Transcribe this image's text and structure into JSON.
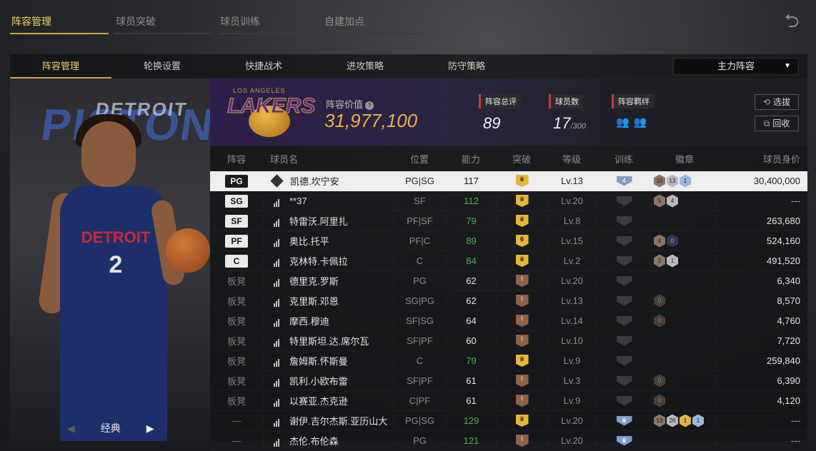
{
  "top_tabs": [
    "阵容管理",
    "球员突破",
    "球员训练",
    "自建加点"
  ],
  "sub_tabs": [
    "阵容管理",
    "轮换设置",
    "快捷战术",
    "进攻策略",
    "防守策略"
  ],
  "lineup_select": "主力阵容",
  "skin": {
    "label": "经典"
  },
  "left_art": {
    "wordmark_big": "PISTONS",
    "wordmark_small": "DETROIT",
    "jersey_text": "DETROIT",
    "jersey_num": "2"
  },
  "team": {
    "logo_top": "LOS ANGELES",
    "logo_word": "LAKERS",
    "value_label": "阵容价值",
    "value": "31,977,100",
    "overall_label": "阵容总评",
    "overall": "89",
    "players_label": "球员数",
    "players_count": "17",
    "players_max": "/300",
    "chemistry_label": "阵容羁绊",
    "btn_select": "选拔",
    "btn_recycle": "回收"
  },
  "table": {
    "headers": [
      "阵容",
      "球员名",
      "位置",
      "能力",
      "突破",
      "等级",
      "训练",
      "徽章",
      "球员身价"
    ],
    "rows": [
      {
        "slot": "PG",
        "name": "凯德.坎宁安",
        "pos": "PG|SG",
        "ovr": "117",
        "brk": "",
        "lvl": "Lv.13",
        "train": "4",
        "badges": [
          "10",
          "13",
          "1"
        ],
        "value": "30,400,000"
      },
      {
        "slot": "SG",
        "name": "**37",
        "pos": "SF",
        "ovr": "112",
        "brk": "",
        "lvl": "Lv.20",
        "train": "",
        "badges": [
          "5",
          "4"
        ],
        "value": "---"
      },
      {
        "slot": "SF",
        "name": "特雷沃.阿里扎",
        "pos": "PF|SF",
        "ovr": "79",
        "brk": "",
        "lvl": "Lv.8",
        "train": "",
        "badges": [],
        "value": "263,680"
      },
      {
        "slot": "PF",
        "name": "奥比.托平",
        "pos": "PF|C",
        "ovr": "89",
        "brk": "6",
        "lvl": "Lv.15",
        "train": "",
        "badges": [
          "4",
          "0"
        ],
        "value": "524,160"
      },
      {
        "slot": "C",
        "name": "克林特.卡佩拉",
        "pos": "C",
        "ovr": "84",
        "brk": "",
        "lvl": "Lv.2",
        "train": "",
        "badges": [
          "2",
          "1"
        ],
        "value": "491,520"
      },
      {
        "slot": "板凳",
        "name": "德里克.罗斯",
        "pos": "PG",
        "ovr": "62",
        "brk": "",
        "lvl": "Lv.20",
        "train": "",
        "badges": [],
        "value": "6,340"
      },
      {
        "slot": "板凳",
        "name": "克里斯.邓恩",
        "pos": "SG|PG",
        "ovr": "62",
        "brk": "",
        "lvl": "Lv.13",
        "train": "",
        "badges": [
          "0"
        ],
        "value": "8,570"
      },
      {
        "slot": "板凳",
        "name": "摩西.穆迪",
        "pos": "SF|SG",
        "ovr": "64",
        "brk": "",
        "lvl": "Lv.14",
        "train": "",
        "badges": [
          "0"
        ],
        "value": "4,760"
      },
      {
        "slot": "板凳",
        "name": "特里斯坦.达.席尔瓦",
        "pos": "SF|PF",
        "ovr": "60",
        "brk": "",
        "lvl": "Lv.10",
        "train": "",
        "badges": [],
        "value": "7,720"
      },
      {
        "slot": "板凳",
        "name": "詹姆斯.怀斯曼",
        "pos": "C",
        "ovr": "79",
        "brk": "",
        "lvl": "Lv.9",
        "train": "",
        "badges": [],
        "value": "259,840"
      },
      {
        "slot": "板凳",
        "name": "凯利.小欧布雷",
        "pos": "SF|PF",
        "ovr": "61",
        "brk": "",
        "lvl": "Lv.3",
        "train": "",
        "badges": [
          "0"
        ],
        "value": "6,390"
      },
      {
        "slot": "板凳",
        "name": "以赛亚.杰克逊",
        "pos": "C|PF",
        "ovr": "61",
        "brk": "",
        "lvl": "Lv.9",
        "train": "",
        "badges": [
          "0"
        ],
        "value": "4,120"
      },
      {
        "slot": "---",
        "name": "谢伊.吉尔杰斯.亚历山大",
        "pos": "PG|SG",
        "ovr": "129",
        "brk": "",
        "lvl": "Lv.20",
        "train": "",
        "badges": [
          "13",
          "26",
          "1",
          "1"
        ],
        "value": "---"
      },
      {
        "slot": "---",
        "name": "杰伦.布伦森",
        "pos": "PG",
        "ovr": "121",
        "brk": "",
        "lvl": "Lv.20",
        "train": "",
        "badges": [],
        "value": "---"
      }
    ]
  }
}
